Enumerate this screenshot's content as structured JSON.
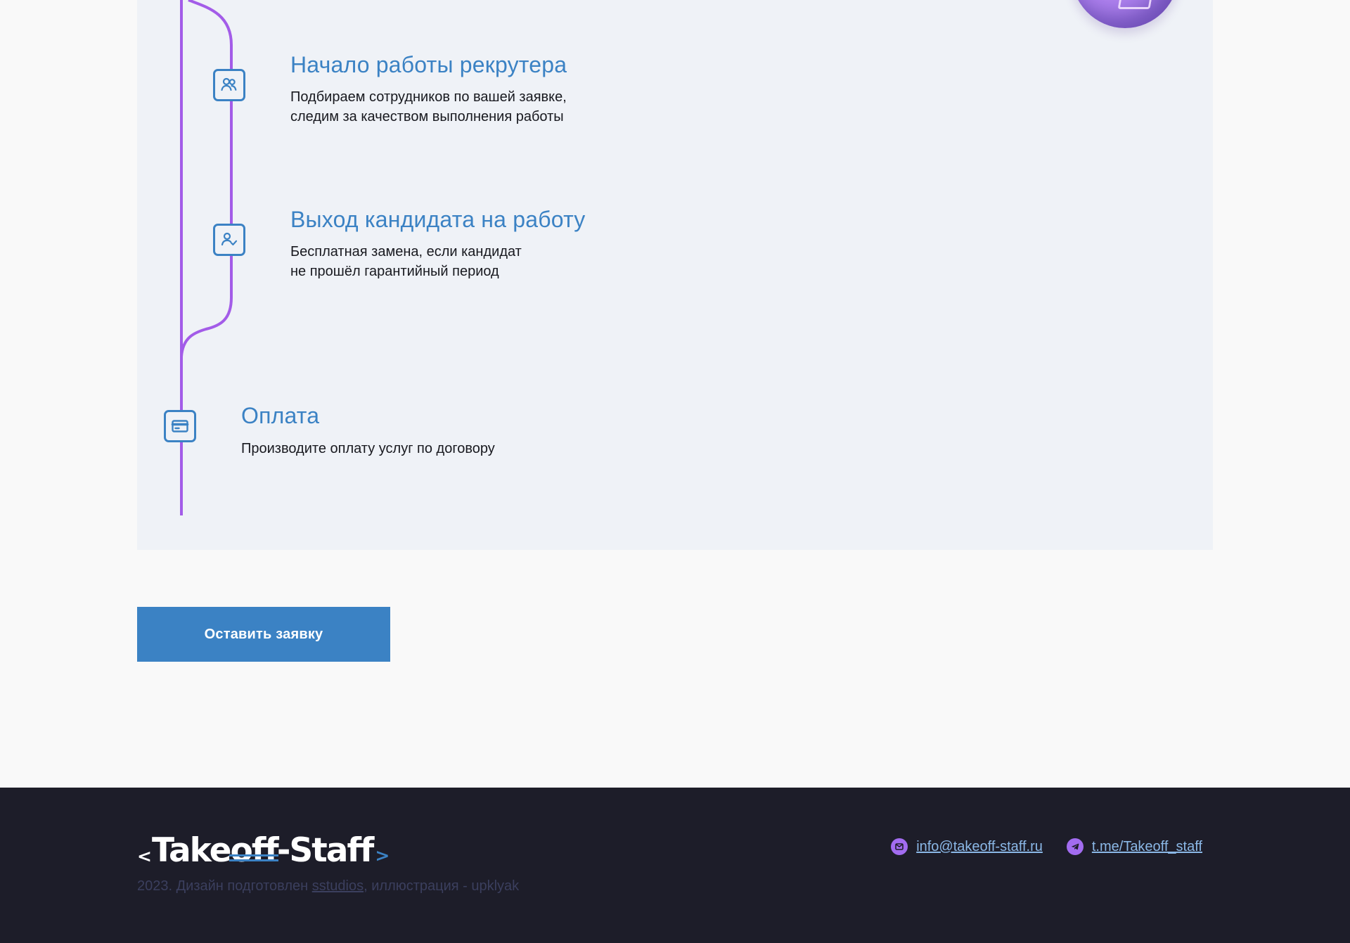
{
  "steps": [
    {
      "title": "Начало работы рекрутера",
      "description": "Подбираем сотрудников по вашей заявке,\nследим за качеством выполнения работы",
      "icon": "users-icon"
    },
    {
      "title": "Выход кандидата на работу",
      "description": "Бесплатная замена, если кандидат\nне прошёл гарантийный период",
      "icon": "user-check-icon"
    },
    {
      "title": "Оплата",
      "description": "Производите оплату услуг по договору",
      "icon": "credit-card-icon"
    }
  ],
  "cta": {
    "label": "Оставить заявку"
  },
  "footer": {
    "logo": {
      "left_bracket": "<",
      "name": "Takeoff-Staff",
      "right_bracket": ">"
    },
    "copyright": {
      "prefix": "2023. Дизайн подготовлен ",
      "studio_link": "sstudios",
      "suffix": ", иллюстрация - upklyak"
    },
    "contacts": [
      {
        "icon": "mail-icon",
        "label": "info@takeoff-staff.ru"
      },
      {
        "icon": "telegram-icon",
        "label": "t.me/Takeoff_staff"
      }
    ]
  },
  "colors": {
    "page_background": "#f9f9f9",
    "panel_background": "#eff2f7",
    "accent_blue": "#3b82c4",
    "timeline_purple": "#a35ce8",
    "footer_background": "#1d1d29",
    "footer_link": "#8bb8e7",
    "icon_purple": "#a26cf0"
  }
}
